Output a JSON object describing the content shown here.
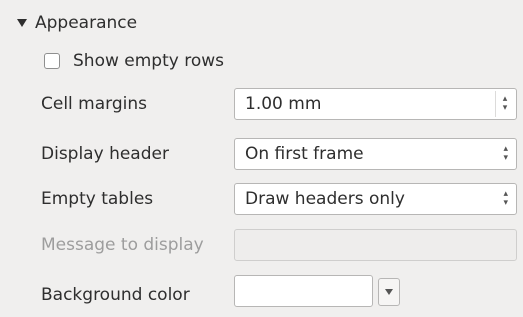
{
  "section": {
    "title": "Appearance",
    "expanded": true,
    "icon": "triangle-down-icon"
  },
  "show_empty_rows": {
    "label": "Show empty rows",
    "checked": false
  },
  "cell_margins": {
    "label": "Cell margins",
    "value": "1.00 mm"
  },
  "display_header": {
    "label": "Display header",
    "value": "On first frame"
  },
  "empty_tables": {
    "label": "Empty tables",
    "value": "Draw headers only"
  },
  "message_to_display": {
    "label": "Message to display",
    "value": "",
    "enabled": false
  },
  "background_color": {
    "label": "Background color",
    "value": "#ffffff"
  },
  "arrows": {
    "up": "▴",
    "down": "▾"
  }
}
